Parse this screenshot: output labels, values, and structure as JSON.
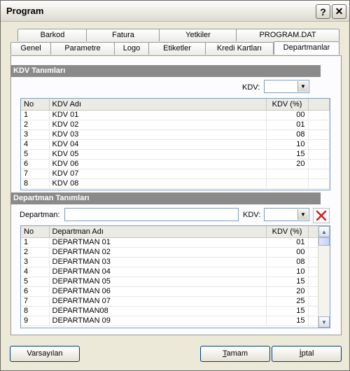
{
  "window": {
    "title": "Program",
    "help_label": "?",
    "close_label": "✕"
  },
  "tabs_back": [
    "Barkod",
    "Fatura",
    "Yetkiler",
    "PROGRAM.DAT"
  ],
  "tabs_front": [
    "Genel",
    "Parametre",
    "Logo",
    "Etiketler",
    "Kredi Kartları",
    "Departmanlar"
  ],
  "kdv_section": {
    "header": "KDV Tanımları",
    "kdv_label": "KDV:",
    "kdv_value": "",
    "columns": [
      "No",
      "KDV Adı",
      "KDV (%)"
    ],
    "rows": [
      [
        "1",
        "KDV 01",
        "00"
      ],
      [
        "2",
        "KDV 02",
        "01"
      ],
      [
        "3",
        "KDV 03",
        "08"
      ],
      [
        "4",
        "KDV 04",
        "10"
      ],
      [
        "5",
        "KDV 05",
        "15"
      ],
      [
        "6",
        "KDV 06",
        "20"
      ],
      [
        "7",
        "KDV 07",
        ""
      ],
      [
        "8",
        "KDV 08",
        ""
      ]
    ]
  },
  "departman_section": {
    "header": "Departman Tanımları",
    "departman_label": "Departman:",
    "departman_value": "",
    "kdv_label": "KDV:",
    "kdv_value": "",
    "columns": [
      "No",
      "Departman Adı",
      "KDV (%)"
    ],
    "rows": [
      [
        "1",
        "DEPARTMAN 01",
        "01"
      ],
      [
        "2",
        "DEPARTMAN 02",
        "00"
      ],
      [
        "3",
        "DEPARTMAN 03",
        "08"
      ],
      [
        "4",
        "DEPARTMAN 04",
        "10"
      ],
      [
        "5",
        "DEPARTMAN 05",
        "15"
      ],
      [
        "6",
        "DEPARTMAN 06",
        "20"
      ],
      [
        "7",
        "DEPARTMAN 07",
        "25"
      ],
      [
        "8",
        "DEPARTMAN08",
        "15"
      ],
      [
        "9",
        "DEPARTMAN 09",
        "15"
      ]
    ]
  },
  "buttons": {
    "defaults": "Varsayılan",
    "ok_first": "T",
    "ok_rest": "amam",
    "cancel_first": "İ",
    "cancel_rest": "ptal"
  },
  "colors": {
    "section_header": "#8a8a8a",
    "delete_icon": "#d22020"
  }
}
